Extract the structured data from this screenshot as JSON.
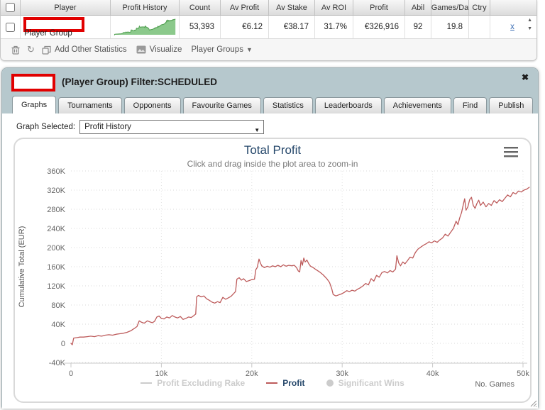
{
  "table": {
    "headers": [
      "Player",
      "Profit History",
      "Count",
      "Av Profit",
      "Av Stake",
      "Av ROI",
      "Profit",
      "Abil",
      "Games/Da",
      "Ctry"
    ],
    "row": {
      "player_label": "Player Group",
      "count": "53,393",
      "av_profit": "€6.12",
      "av_stake": "€38.17",
      "av_roi": "31.7%",
      "profit": "€326,916",
      "abil": "92",
      "games_per_day": "19.8",
      "ctry": "",
      "remove_link": "x"
    }
  },
  "toolbar": {
    "add_other_statistics": "Add Other Statistics",
    "visualize": "Visualize",
    "player_groups": "Player Groups"
  },
  "panel": {
    "title": "(Player Group) Filter:SCHEDULED",
    "close_icon": "✖"
  },
  "tabs": [
    {
      "label": "Graphs",
      "active": true
    },
    {
      "label": "Tournaments",
      "active": false
    },
    {
      "label": "Opponents",
      "active": false
    },
    {
      "label": "Favourite Games",
      "active": false
    },
    {
      "label": "Statistics",
      "active": false
    },
    {
      "label": "Leaderboards",
      "active": false
    },
    {
      "label": "Achievements",
      "active": false
    },
    {
      "label": "Find",
      "active": false
    },
    {
      "label": "Publish",
      "active": false
    }
  ],
  "graph_selector": {
    "label": "Graph Selected:",
    "value": "Profit History"
  },
  "colors": {
    "profit_line": "#bd5b5b",
    "sparkline_fill": "#8bc98b",
    "sparkline_stroke": "#51a051",
    "panel_header_bg": "#b6c8cd",
    "chart_title": "#26486b",
    "redaction_border": "#e10000",
    "legend_disabled": "#cccccc"
  },
  "chart_data": {
    "type": "line",
    "title": "Total Profit",
    "subtitle": "Click and drag inside the plot area to zoom-in",
    "xlabel": "No. Games",
    "ylabel": "Cumulative Total (EUR)",
    "grid": "dotted",
    "legend_position": "bottom",
    "x_unit": "thousands of games",
    "y_unit": "thousands of EUR",
    "xlim": [
      0,
      51
    ],
    "ylim": [
      -40,
      360
    ],
    "x_ticks": [
      {
        "label": "0",
        "v": 0
      },
      {
        "label": "10k",
        "v": 10
      },
      {
        "label": "20k",
        "v": 20
      },
      {
        "label": "30k",
        "v": 30
      },
      {
        "label": "40k",
        "v": 40
      },
      {
        "label": "50k",
        "v": 50
      }
    ],
    "y_ticks": [
      {
        "label": "360K",
        "v": 360
      },
      {
        "label": "320K",
        "v": 320
      },
      {
        "label": "280K",
        "v": 280
      },
      {
        "label": "240K",
        "v": 240
      },
      {
        "label": "200K",
        "v": 200
      },
      {
        "label": "160K",
        "v": 160
      },
      {
        "label": "120K",
        "v": 120
      },
      {
        "label": "80K",
        "v": 80
      },
      {
        "label": "40K",
        "v": 40
      },
      {
        "label": "0",
        "v": 0
      },
      {
        "label": "-40K",
        "v": -40
      }
    ],
    "legend": [
      {
        "name": "Profit Excluding Rake",
        "enabled": false,
        "color": "#cccccc",
        "marker": "line"
      },
      {
        "name": "Profit",
        "enabled": true,
        "color": "#bd5b5b",
        "marker": "line"
      },
      {
        "name": "Significant Wins",
        "enabled": false,
        "color": "#cccccc",
        "marker": "circle"
      }
    ],
    "series": [
      {
        "name": "Profit",
        "color": "#bd5b5b",
        "points": [
          [
            0,
            0
          ],
          [
            0.15,
            -3
          ],
          [
            0.3,
            11
          ],
          [
            0.7,
            12
          ],
          [
            1,
            13
          ],
          [
            1.4,
            13
          ],
          [
            1.8,
            14
          ],
          [
            2.2,
            15
          ],
          [
            2.6,
            14
          ],
          [
            3,
            16
          ],
          [
            3.4,
            15
          ],
          [
            3.8,
            17
          ],
          [
            4.2,
            18
          ],
          [
            4.6,
            17
          ],
          [
            5,
            19
          ],
          [
            5.4,
            20
          ],
          [
            5.8,
            21
          ],
          [
            6.2,
            23
          ],
          [
            6.6,
            26
          ],
          [
            7,
            31
          ],
          [
            7.3,
            35
          ],
          [
            7.55,
            47
          ],
          [
            7.8,
            44
          ],
          [
            8.1,
            42
          ],
          [
            8.45,
            47
          ],
          [
            8.7,
            45
          ],
          [
            9,
            43
          ],
          [
            9.25,
            46
          ],
          [
            9.5,
            55
          ],
          [
            9.75,
            57
          ],
          [
            10,
            52
          ],
          [
            10.3,
            51
          ],
          [
            10.6,
            55
          ],
          [
            10.9,
            53
          ],
          [
            11.2,
            58
          ],
          [
            11.5,
            55
          ],
          [
            11.8,
            53
          ],
          [
            12.1,
            56
          ],
          [
            12.4,
            50
          ],
          [
            12.7,
            52
          ],
          [
            13,
            55
          ],
          [
            13.3,
            54
          ],
          [
            13.6,
            58
          ],
          [
            13.8,
            61
          ],
          [
            13.9,
            97
          ],
          [
            14.1,
            100
          ],
          [
            14.4,
            97
          ],
          [
            14.7,
            99
          ],
          [
            15,
            93
          ],
          [
            15.3,
            90
          ],
          [
            15.6,
            86
          ],
          [
            15.9,
            84
          ],
          [
            16.2,
            87
          ],
          [
            16.5,
            85
          ],
          [
            16.8,
            96
          ],
          [
            17.1,
            92
          ],
          [
            17.4,
            95
          ],
          [
            17.7,
            98
          ],
          [
            18,
            104
          ],
          [
            18.2,
            108
          ],
          [
            18.35,
            134
          ],
          [
            18.6,
            137
          ],
          [
            18.85,
            132
          ],
          [
            19.1,
            135
          ],
          [
            19.4,
            129
          ],
          [
            19.7,
            131
          ],
          [
            20,
            133
          ],
          [
            20.3,
            134
          ],
          [
            20.45,
            154
          ],
          [
            20.6,
            158
          ],
          [
            20.8,
            176
          ],
          [
            20.95,
            168
          ],
          [
            21.1,
            162
          ],
          [
            21.4,
            158
          ],
          [
            21.7,
            161
          ],
          [
            22,
            159
          ],
          [
            22.3,
            162
          ],
          [
            22.6,
            160
          ],
          [
            22.9,
            163
          ],
          [
            23.2,
            160
          ],
          [
            23.5,
            164
          ],
          [
            23.8,
            161
          ],
          [
            24.1,
            163
          ],
          [
            24.4,
            162
          ],
          [
            24.7,
            163
          ],
          [
            24.95,
            158
          ],
          [
            25.15,
            151
          ],
          [
            25.3,
            149
          ],
          [
            25.45,
            173
          ],
          [
            25.6,
            163
          ],
          [
            25.75,
            178
          ],
          [
            25.9,
            170
          ],
          [
            26.1,
            174
          ],
          [
            26.3,
            166
          ],
          [
            26.5,
            161
          ],
          [
            26.8,
            158
          ],
          [
            27.1,
            154
          ],
          [
            27.5,
            149
          ],
          [
            27.9,
            143
          ],
          [
            28.3,
            135
          ],
          [
            28.6,
            127
          ],
          [
            28.85,
            114
          ],
          [
            29,
            102
          ],
          [
            29.3,
            99
          ],
          [
            29.6,
            101
          ],
          [
            29.9,
            103
          ],
          [
            30.2,
            106
          ],
          [
            30.5,
            110
          ],
          [
            30.8,
            108
          ],
          [
            31.1,
            111
          ],
          [
            31.4,
            109
          ],
          [
            31.7,
            113
          ],
          [
            32,
            116
          ],
          [
            32.3,
            120
          ],
          [
            32.6,
            125
          ],
          [
            32.9,
            122
          ],
          [
            33.2,
            135
          ],
          [
            33.5,
            130
          ],
          [
            33.8,
            142
          ],
          [
            34.1,
            138
          ],
          [
            34.4,
            148
          ],
          [
            34.7,
            150
          ],
          [
            35,
            147
          ],
          [
            35.3,
            152
          ],
          [
            35.6,
            149
          ],
          [
            35.9,
            155
          ],
          [
            36.05,
            183
          ],
          [
            36.25,
            168
          ],
          [
            36.45,
            162
          ],
          [
            36.7,
            170
          ],
          [
            36.95,
            166
          ],
          [
            37.2,
            172
          ],
          [
            37.5,
            180
          ],
          [
            37.8,
            178
          ],
          [
            38.1,
            190
          ],
          [
            38.4,
            197
          ],
          [
            38.7,
            201
          ],
          [
            39,
            205
          ],
          [
            39.3,
            208
          ],
          [
            39.6,
            212
          ],
          [
            39.9,
            210
          ],
          [
            40.2,
            214
          ],
          [
            40.5,
            211
          ],
          [
            40.8,
            216
          ],
          [
            41.1,
            220
          ],
          [
            41.4,
            228
          ],
          [
            41.7,
            224
          ],
          [
            42,
            232
          ],
          [
            42.3,
            240
          ],
          [
            42.6,
            255
          ],
          [
            42.8,
            248
          ],
          [
            43,
            262
          ],
          [
            43.2,
            273
          ],
          [
            43.4,
            290
          ],
          [
            43.55,
            302
          ],
          [
            43.7,
            278
          ],
          [
            43.9,
            285
          ],
          [
            44.1,
            300
          ],
          [
            44.3,
            305
          ],
          [
            44.5,
            288
          ],
          [
            44.7,
            282
          ],
          [
            44.9,
            292
          ],
          [
            45.1,
            299
          ],
          [
            45.3,
            288
          ],
          [
            45.6,
            295
          ],
          [
            45.9,
            285
          ],
          [
            46.2,
            292
          ],
          [
            46.5,
            288
          ],
          [
            46.8,
            298
          ],
          [
            47.1,
            293
          ],
          [
            47.4,
            300
          ],
          [
            47.7,
            296
          ],
          [
            48,
            303
          ],
          [
            48.3,
            310
          ],
          [
            48.6,
            306
          ],
          [
            48.9,
            315
          ],
          [
            49.2,
            312
          ],
          [
            49.5,
            318
          ],
          [
            49.8,
            316
          ],
          [
            50.1,
            320
          ],
          [
            50.4,
            322
          ],
          [
            50.7,
            326
          ]
        ]
      }
    ]
  }
}
